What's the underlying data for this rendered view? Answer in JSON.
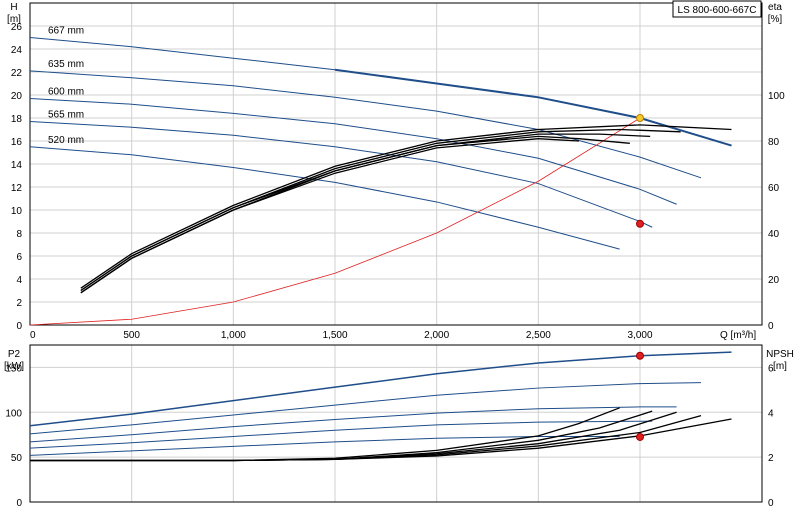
{
  "title_box": "LS 800-600-667C",
  "chart_data": [
    {
      "type": "line",
      "panel": "head",
      "y_left_label": [
        "H",
        "[m]"
      ],
      "y_right_label": [
        "eta",
        "[%]"
      ],
      "x_label": "Q [m³/h]",
      "xlim": [
        0,
        3600
      ],
      "ylim": [
        0,
        28
      ],
      "y2lim": [
        0,
        140
      ],
      "x_ticks": [
        "0",
        "500",
        "1,000",
        "1,500",
        "2,000",
        "2,500",
        "3,000"
      ],
      "x_tick_values": [
        0,
        500,
        1000,
        1500,
        2000,
        2500,
        3000
      ],
      "y_ticks": [
        0,
        2,
        4,
        6,
        8,
        10,
        12,
        14,
        16,
        18,
        20,
        22,
        24,
        26
      ],
      "y2_ticks": [
        0,
        20,
        40,
        60,
        80,
        100
      ],
      "grid": true,
      "series": [
        {
          "name": "667 mm",
          "color": "#1f4e8a",
          "width": 1,
          "x": [
            0,
            500,
            1000,
            1500,
            2000,
            2500,
            3000,
            3450
          ],
          "y": [
            25.0,
            24.2,
            23.2,
            22.2,
            21.0,
            19.8,
            18.0,
            15.6
          ]
        },
        {
          "name": "635 mm",
          "color": "#1f4e8a",
          "width": 1,
          "x": [
            0,
            500,
            1000,
            1500,
            2000,
            2500,
            3000,
            3300
          ],
          "y": [
            22.1,
            21.5,
            20.8,
            19.8,
            18.6,
            17.0,
            14.6,
            12.8
          ]
        },
        {
          "name": "600 mm",
          "color": "#1f4e8a",
          "width": 1,
          "x": [
            0,
            500,
            1000,
            1500,
            2000,
            2500,
            3000,
            3180
          ],
          "y": [
            19.7,
            19.2,
            18.4,
            17.5,
            16.2,
            14.5,
            11.8,
            10.5
          ]
        },
        {
          "name": "565 mm",
          "color": "#1f4e8a",
          "width": 1,
          "x": [
            0,
            500,
            1000,
            1500,
            2000,
            2500,
            3000,
            3060
          ],
          "y": [
            17.7,
            17.2,
            16.5,
            15.5,
            14.2,
            12.3,
            9.0,
            8.5
          ]
        },
        {
          "name": "520 mm",
          "color": "#1f4e8a",
          "width": 1,
          "x": [
            0,
            500,
            1000,
            1500,
            2000,
            2500,
            2900
          ],
          "y": [
            15.5,
            14.8,
            13.7,
            12.4,
            10.7,
            8.5,
            6.6
          ]
        },
        {
          "name": "",
          "color": "#e02020",
          "width": 0.8,
          "x": [
            0,
            500,
            1000,
            1500,
            2000,
            2500,
            3000
          ],
          "y": [
            0,
            0.5,
            2.0,
            4.5,
            8.0,
            12.5,
            18.0
          ]
        }
      ],
      "eta_series": [
        {
          "x": [
            250,
            500,
            1000,
            1500,
            2000,
            2500,
            3000,
            3450
          ],
          "y": [
            16,
            31,
            52,
            69,
            80,
            85,
            87,
            85
          ]
        },
        {
          "x": [
            250,
            500,
            1000,
            1500,
            2000,
            2500,
            2900,
            3200
          ],
          "y": [
            15,
            30,
            51,
            68,
            79,
            84,
            85,
            84
          ]
        },
        {
          "x": [
            250,
            500,
            1000,
            1500,
            2000,
            2500,
            2800,
            3050
          ],
          "y": [
            15,
            30,
            51,
            67,
            78,
            83,
            83,
            82
          ]
        },
        {
          "x": [
            250,
            500,
            1000,
            1500,
            2000,
            2500,
            2700,
            2950
          ],
          "y": [
            14,
            29,
            50,
            67,
            78,
            82,
            81,
            79
          ]
        },
        {
          "x": [
            250,
            500,
            1000,
            1500,
            2000,
            2500,
            2700
          ],
          "y": [
            14,
            29,
            50,
            66,
            77,
            81,
            80
          ]
        }
      ],
      "points": [
        {
          "x": 3000,
          "y": 18.0,
          "color": "#f2c830",
          "stroke": "#c08000"
        },
        {
          "x": 3000,
          "y": 8.8,
          "color": "#e02020",
          "stroke": "#a00000"
        }
      ]
    },
    {
      "type": "line",
      "panel": "power",
      "y_left_label": [
        "P2",
        "[kW]"
      ],
      "y_right_label": [
        "NPSH",
        "[m]"
      ],
      "xlim": [
        0,
        3600
      ],
      "ylim": [
        0,
        175
      ],
      "y2lim": [
        0,
        7
      ],
      "y_ticks": [
        0,
        50,
        100,
        150
      ],
      "y2_ticks": [
        0,
        2,
        4,
        6
      ],
      "grid": true,
      "power_series": [
        {
          "x": [
            0,
            500,
            1000,
            1500,
            2000,
            2500,
            3000,
            3450
          ],
          "y": [
            85,
            98,
            113,
            128,
            143,
            155,
            163,
            167
          ]
        },
        {
          "x": [
            0,
            500,
            1000,
            1500,
            2000,
            2500,
            3000,
            3300
          ],
          "y": [
            76,
            86,
            97,
            108,
            119,
            127,
            132,
            133
          ]
        },
        {
          "x": [
            0,
            500,
            1000,
            1500,
            2000,
            2500,
            3000,
            3180
          ],
          "y": [
            67,
            75,
            84,
            92,
            99,
            104,
            106,
            106
          ]
        },
        {
          "x": [
            0,
            500,
            1000,
            1500,
            2000,
            2500,
            3000,
            3060
          ],
          "y": [
            60,
            66,
            73,
            80,
            86,
            89,
            90,
            90
          ]
        },
        {
          "x": [
            0,
            500,
            1000,
            1500,
            2000,
            2500,
            2900
          ],
          "y": [
            52,
            57,
            62,
            67,
            71,
            73,
            73
          ]
        }
      ],
      "npsh_series": [
        {
          "x": [
            0,
            500,
            1000,
            1500,
            2000,
            2500,
            3000,
            3450
          ],
          "y": [
            1.85,
            1.85,
            1.85,
            1.9,
            2.05,
            2.4,
            2.95,
            3.7
          ]
        },
        {
          "x": [
            0,
            500,
            1000,
            1500,
            2000,
            2500,
            3000,
            3300
          ],
          "y": [
            1.85,
            1.85,
            1.85,
            1.9,
            2.1,
            2.5,
            3.1,
            3.85
          ]
        },
        {
          "x": [
            0,
            500,
            1000,
            1500,
            2000,
            2500,
            2900,
            3180
          ],
          "y": [
            1.85,
            1.85,
            1.85,
            1.9,
            2.15,
            2.6,
            3.2,
            4.0
          ]
        },
        {
          "x": [
            0,
            500,
            1000,
            1500,
            2000,
            2500,
            2800,
            3060
          ],
          "y": [
            1.85,
            1.85,
            1.85,
            1.9,
            2.2,
            2.75,
            3.3,
            4.05
          ]
        },
        {
          "x": [
            0,
            500,
            1000,
            1500,
            2000,
            2500,
            2700,
            2900
          ],
          "y": [
            1.85,
            1.85,
            1.85,
            1.95,
            2.3,
            2.95,
            3.5,
            4.2
          ]
        }
      ],
      "points": [
        {
          "x": 3000,
          "y": 163,
          "axis": "left",
          "color": "#e02020",
          "stroke": "#a00000"
        },
        {
          "x": 3000,
          "y": 2.9,
          "axis": "right",
          "color": "#e02020",
          "stroke": "#a00000"
        }
      ]
    }
  ]
}
